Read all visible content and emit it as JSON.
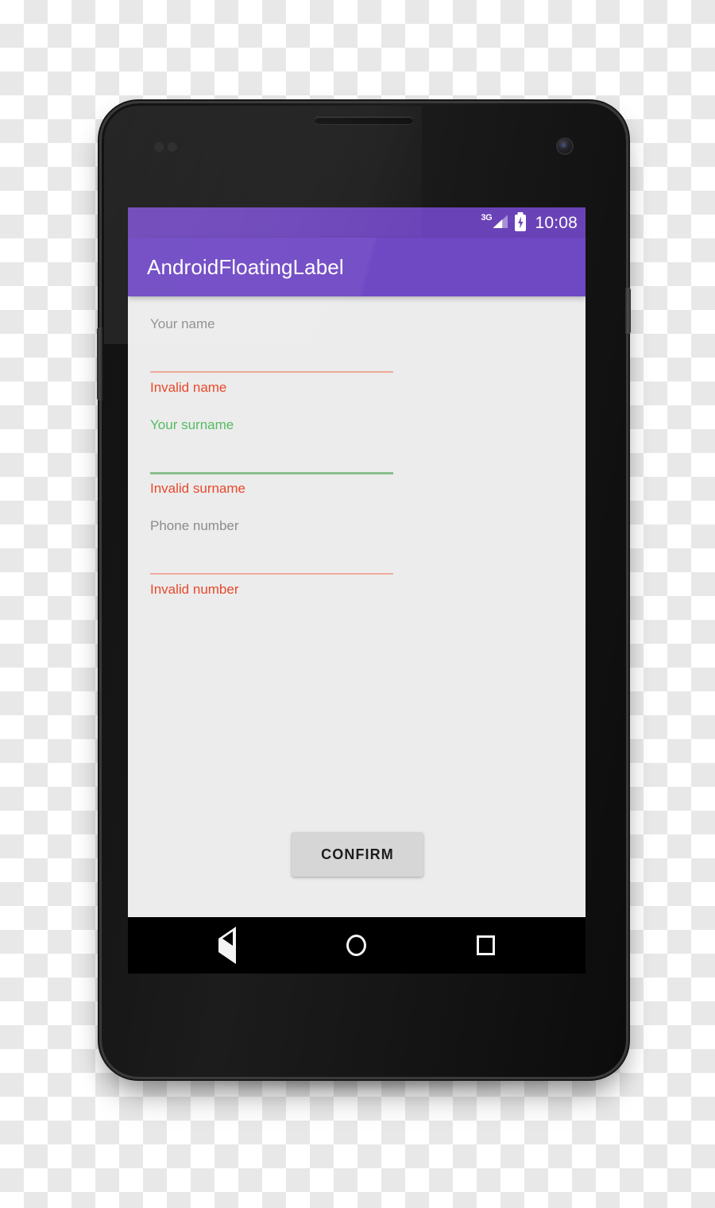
{
  "device": {
    "name": "android-phone-mockup",
    "hardware": {
      "earpiece": "earpiece-speaker",
      "front_camera": "front-camera",
      "proximity_sensor": "proximity-sensor",
      "power_button": "power-button",
      "volume_button": "volume-button"
    }
  },
  "status_bar": {
    "network_type": "3G",
    "battery_state": "charging",
    "clock": "10:08",
    "background_color": "#6a42b8"
  },
  "app_bar": {
    "title": "AndroidFloatingLabel",
    "background_color": "#6f48c4",
    "text_color": "#ffffff"
  },
  "form": {
    "fields": [
      {
        "label": "Your name",
        "value": "",
        "label_state": "hint",
        "label_color": "#8c8c8c",
        "underline_color": "#eeaa99",
        "underline_state": "error-light",
        "error": "Invalid name",
        "error_color": "#e8492c"
      },
      {
        "label": "Your surname",
        "value": "",
        "label_state": "accent",
        "label_color": "#56bb63",
        "underline_color": "#8cbf8c",
        "underline_state": "ok",
        "error": "Invalid surname",
        "error_color": "#e8492c"
      },
      {
        "label": "Phone number",
        "value": "",
        "label_state": "hint",
        "label_color": "#8c8c8c",
        "underline_color": "#eeaa99",
        "underline_state": "error-light",
        "error": "Invalid number",
        "error_color": "#e8492c"
      }
    ],
    "confirm_label": "CONFIRM",
    "background_color": "#ececec"
  },
  "nav_bar": {
    "background_color": "#000000",
    "keys": [
      {
        "name": "back",
        "glyph": "triangle-left-outline"
      },
      {
        "name": "home",
        "glyph": "circle-outline"
      },
      {
        "name": "recents",
        "glyph": "square-outline"
      }
    ]
  }
}
